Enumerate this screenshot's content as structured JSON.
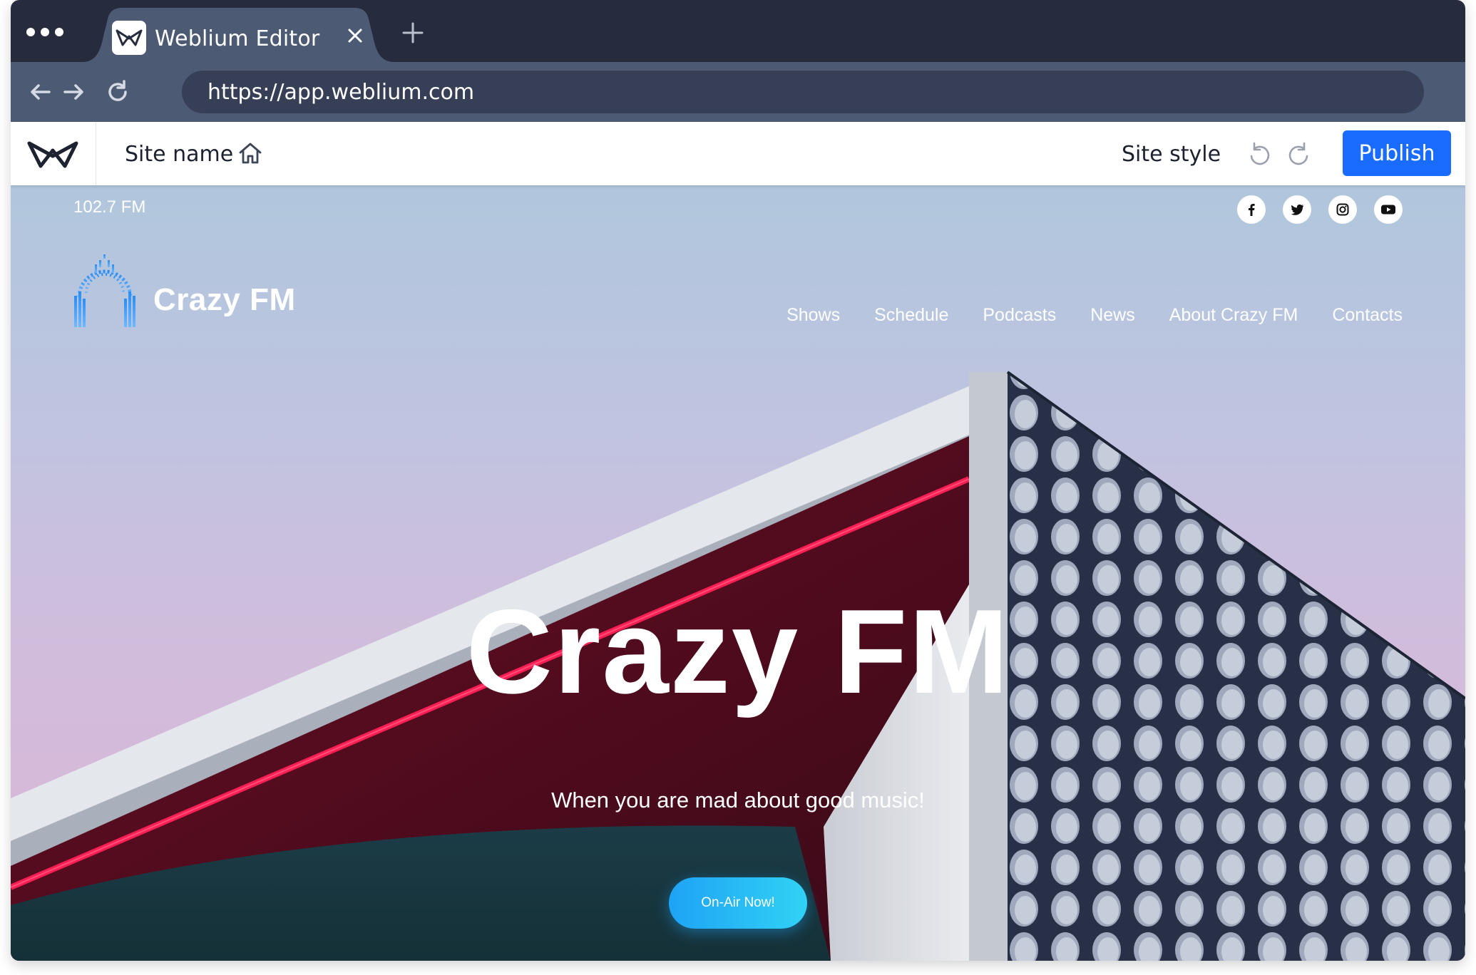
{
  "browser": {
    "tab_title": "Weblium Editor",
    "url": "https://app.weblium.com"
  },
  "editor": {
    "site_name": "Site name",
    "site_style": "Site style",
    "publish_label": "Publish",
    "accent_color": "#1a6bff"
  },
  "site": {
    "frequency": "102.7 FM",
    "brand": "Crazy FM",
    "socials": [
      "facebook-icon",
      "twitter-icon",
      "instagram-icon",
      "youtube-icon"
    ],
    "menu": [
      "Shows",
      "Schedule",
      "Podcasts",
      "News",
      "About Crazy FM",
      "Contacts"
    ],
    "hero_title": "Crazy FM",
    "hero_subtitle": "When you are mad about good music!",
    "cta_label": "On-Air Now!"
  }
}
